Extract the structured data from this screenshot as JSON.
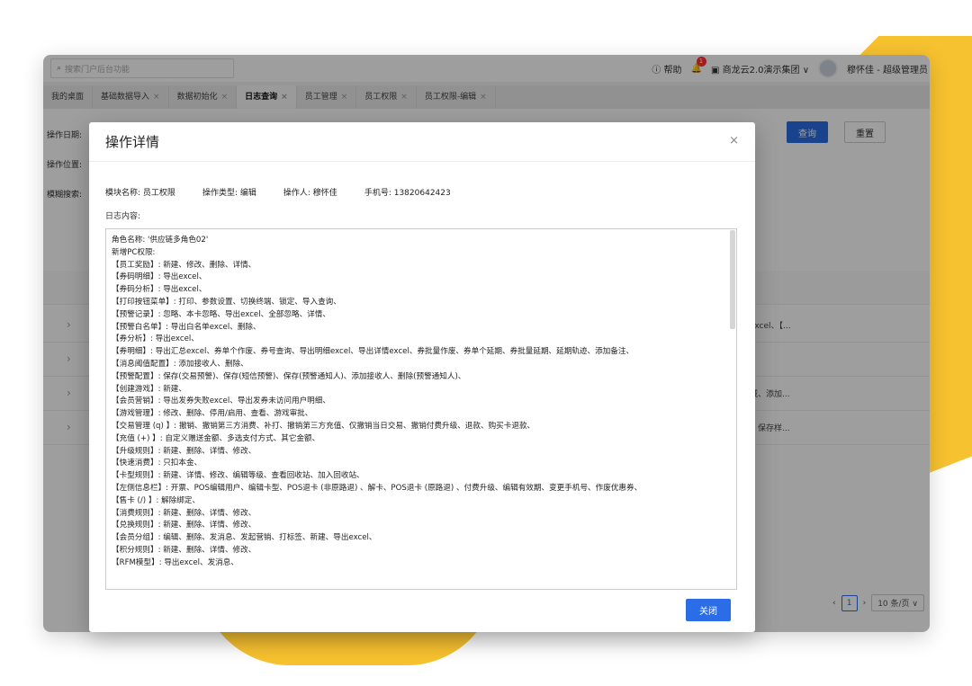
{
  "search": {
    "placeholder": "搜索门户后台功能"
  },
  "topbar": {
    "help": "帮助",
    "notif_count": "1",
    "org": "商龙云2.0演示集团 ∨",
    "user": "穆怀佳 - 超级管理员"
  },
  "tabs": [
    {
      "label": "我的桌面"
    },
    {
      "label": "基础数据导入"
    },
    {
      "label": "数据初始化"
    },
    {
      "label": "日志查询"
    },
    {
      "label": "员工管理"
    },
    {
      "label": "员工权限"
    },
    {
      "label": "员工权限-编辑"
    }
  ],
  "filters": [
    "操作日期:",
    "操作位置:",
    "模糊搜索:"
  ],
  "buttons": {
    "query": "查询",
    "reset": "重置",
    "close": "关闭"
  },
  "rows_right": [
    "出excel、【...",
    "",
    "区域、添加...",
    "站、保存样..."
  ],
  "pager": {
    "page": "1",
    "size": "10 条/页 ∨"
  },
  "modal": {
    "title": "操作详情",
    "meta": [
      {
        "k": "模块名称:",
        "v": "员工权限"
      },
      {
        "k": "操作类型:",
        "v": "编辑"
      },
      {
        "k": "操作人:",
        "v": "穆怀佳"
      },
      {
        "k": "手机号:",
        "v": "13820642423"
      }
    ],
    "log_label": "日志内容:",
    "log_lines": [
      "角色名称: '供应链多角色02'",
      "新增PC权限:",
      "【员工奖励】: 新建、修改、删除、详情、",
      "【券码明细】: 导出excel、",
      "【券码分析】: 导出excel、",
      "【打印按钮菜单】: 打印、参数设置、切换终端、锁定、导入查询、",
      "【预警记录】: 忽略、本卡忽略、导出excel、全部忽略、详情、",
      "【预警白名单】: 导出白名单excel、删除、",
      "【券分析】: 导出excel、",
      "【券明细】: 导出汇总excel、券单个作废、券号查询、导出明细excel、导出详情excel、券批量作废、券单个延期、券批量延期、延期轨迹、添加备注、",
      "【消息阈值配置】: 添加接收人、删除、",
      "【预警配置】: 保存(交易预警)、保存(短信预警)、保存(预警通知人)、添加接收人、删除(预警通知人)、",
      "【创建游戏】: 新建、",
      "【会员营销】: 导出发券失败excel、导出发券未访问用户明细、",
      "【游戏管理】: 修改、删除、停用/启用、查看、游戏审批、",
      "【交易管理 (q) 】: 撤销、撤销第三方消费、补打、撤销第三方充值、仅撤销当日交易、撤销付费升级、退款、购买卡退款、",
      "【充值 (+) 】: 自定义赠送金额、多选支付方式、其它金额、",
      "【升级规则】: 新建、删除、详情、修改、",
      "【快速消费】: 只扣本金、",
      "【卡型规则】: 新建、详情、修改、编辑等级、查看回收站、加入回收站、",
      "【左侧信息栏】: 开票、POS编辑用户、编辑卡型、POS退卡 (非原路退) 、解卡、POS退卡 (原路退) 、付费升级、编辑有效期、变更手机号、作废优惠券、",
      "【售卡 (/) 】: 解除绑定、",
      "【消费规则】: 新建、删除、详情、修改、",
      "【兑换规则】: 新建、删除、详情、修改、",
      "【会员分组】: 编辑、删除、发消息、发起营销、打标签、新建、导出excel、",
      "【积分规则】: 新建、删除、详情、修改、",
      "【RFM模型】: 导出excel、发消息、"
    ]
  }
}
